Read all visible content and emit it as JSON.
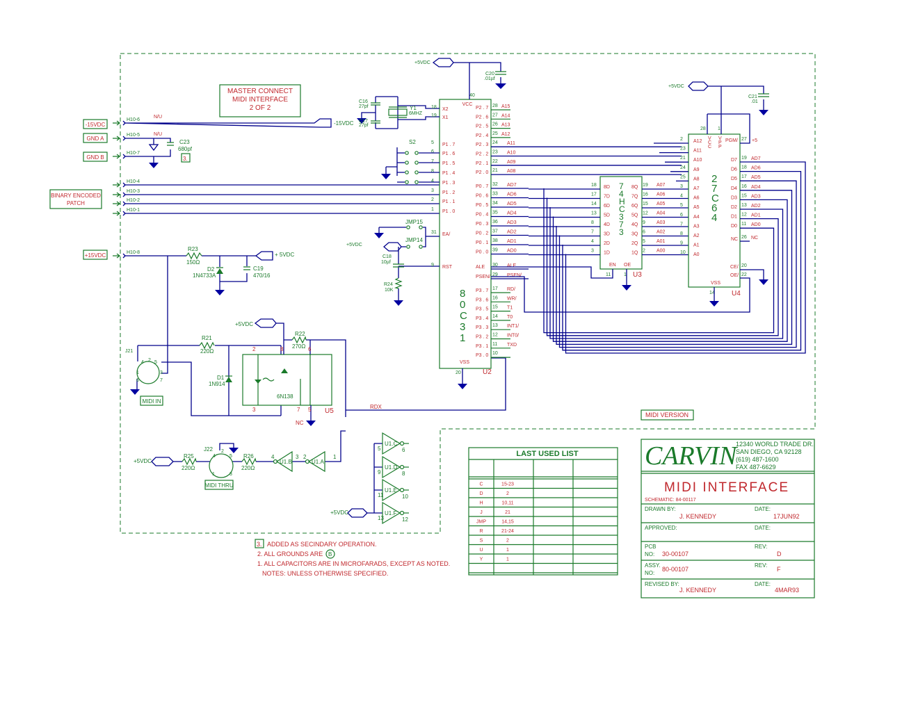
{
  "sheet": {
    "master_box": [
      "MASTER CONNECT",
      "MIDI INTERFACE",
      "2 OF 2"
    ],
    "midi_version_label": "MIDI VERSION"
  },
  "connectors": {
    "neg15": "-15VDC",
    "gnd_a": "GND A",
    "gnd_b": "GND B",
    "binary": [
      "BINARY ENCODED",
      "PATCH"
    ],
    "pos15": "+15VDC",
    "pins": [
      "H10-6",
      "H10-5",
      "H10-7",
      "H10-4",
      "H10-3",
      "H10-2",
      "H10-1",
      "H10-8"
    ],
    "nu": "N/U",
    "neg15_out": "-15VDC",
    "c23": "C23",
    "c23_val": "680pf",
    "note3": "3."
  },
  "power": {
    "r23": "R23",
    "r23_val": "150Ω",
    "d2": "D2",
    "d2_val": "1N4733A",
    "c19": "C19",
    "c19_val": "470/16",
    "out": "+ 5VDC"
  },
  "midi_in": {
    "j21": "J21",
    "label": "MIDI IN",
    "r21": "R21",
    "r21_val": "220Ω",
    "d1": "D1",
    "d1_val": "1N914",
    "r22": "R22",
    "r22_val": "270Ω",
    "vcc": "+5VDC",
    "opto": "6N138",
    "opto_ref": "U5",
    "nc": "NC",
    "rdx": "RDX",
    "pins": [
      "2",
      "8",
      "6",
      "3",
      "7",
      "5"
    ],
    "din_pins": [
      "4",
      "2",
      "5",
      "1",
      "3",
      "6",
      "7"
    ]
  },
  "midi_thru": {
    "vcc": "+5VDC",
    "r25": "R25",
    "r25_val": "220Ω",
    "j22": "J22",
    "label": "MIDI THRU",
    "r26": "R26",
    "r26_val": "220Ω",
    "u1b": "U1.B",
    "u1a": "U1.A",
    "pins": [
      "4",
      "3",
      "2",
      "1"
    ],
    "din_pins": [
      "4",
      "2",
      "5",
      "1",
      "3"
    ]
  },
  "spare_inverters": {
    "vcc": "+5VDC",
    "gates": [
      {
        "name": "U1.C",
        "in": "5",
        "out": "6"
      },
      {
        "name": "U1.D",
        "in": "9",
        "out": "8"
      },
      {
        "name": "U1.E",
        "in": "11",
        "out": "10"
      },
      {
        "name": "U1.F",
        "in": "13",
        "out": "12"
      }
    ]
  },
  "u2": {
    "ref": "U2",
    "part": [
      "8",
      "0",
      "C",
      "3",
      "1"
    ],
    "vcc": "VCC",
    "vss": "VSS",
    "vcc_pin": "40",
    "vss_pin": "20",
    "vcc_src": "+5VDC",
    "c20": "C20",
    "c20_val": ".01µf",
    "c16": "C16",
    "c16_val": "27pf",
    "c17": "C17",
    "c17_val": "27pf",
    "y1": "Y1",
    "y1_val": "6MHZ",
    "s2": "S2",
    "jmp15": "JMP15",
    "jmp14": "JMP14",
    "jmp_vcc": "+5VDC",
    "c18": "C18",
    "c18_val": "10µf",
    "r24": "R24",
    "r24_val": "10K",
    "left": [
      {
        "pin": "18",
        "name": "X2"
      },
      {
        "pin": "19",
        "name": "X1"
      },
      {
        "pin": "5",
        "name": "P1 . 7"
      },
      {
        "pin": "6",
        "name": "P1 . 6"
      },
      {
        "pin": "7",
        "name": "P1 . 5"
      },
      {
        "pin": "8",
        "name": "P1 . 4"
      },
      {
        "pin": "4",
        "name": "P1 . 3"
      },
      {
        "pin": "3",
        "name": "P1 . 2"
      },
      {
        "pin": "2",
        "name": "P1 . 1"
      },
      {
        "pin": "1",
        "name": "P1 . 0"
      },
      {
        "pin": "31",
        "name": "EA/"
      },
      {
        "pin": "9",
        "name": "RST"
      }
    ],
    "right": [
      {
        "pin": "28",
        "name": "P2 . 7",
        "net": "A15"
      },
      {
        "pin": "27",
        "name": "P2 . 6",
        "net": "A14"
      },
      {
        "pin": "26",
        "name": "P2 . 5",
        "net": "A13"
      },
      {
        "pin": "25",
        "name": "P2 . 4",
        "net": "A12"
      },
      {
        "pin": "24",
        "name": "P2 . 3",
        "net": "A11"
      },
      {
        "pin": "23",
        "name": "P2 . 2",
        "net": "A10"
      },
      {
        "pin": "22",
        "name": "P2 . 1",
        "net": "A09"
      },
      {
        "pin": "21",
        "name": "P2 . 0",
        "net": "A08"
      },
      {
        "pin": "32",
        "name": "P0 . 7",
        "net": "AD7"
      },
      {
        "pin": "33",
        "name": "P0 . 6",
        "net": "AD6"
      },
      {
        "pin": "34",
        "name": "P0 . 5",
        "net": "AD5"
      },
      {
        "pin": "35",
        "name": "P0 . 4",
        "net": "AD4"
      },
      {
        "pin": "36",
        "name": "P0 . 3",
        "net": "AD3"
      },
      {
        "pin": "37",
        "name": "P0 . 2",
        "net": "AD2"
      },
      {
        "pin": "38",
        "name": "P0 . 1",
        "net": "AD1"
      },
      {
        "pin": "39",
        "name": "P0 . 0",
        "net": "AD0"
      },
      {
        "pin": "30",
        "name": "ALE",
        "net": "ALE"
      },
      {
        "pin": "29",
        "name": "PSEN/",
        "net": "PSEN/"
      },
      {
        "pin": "17",
        "name": "P3 . 7",
        "net": "RD/"
      },
      {
        "pin": "16",
        "name": "P3 . 6",
        "net": "WR/"
      },
      {
        "pin": "15",
        "name": "P3 . 5",
        "net": "T1"
      },
      {
        "pin": "14",
        "name": "P3 . 4",
        "net": "T0"
      },
      {
        "pin": "13",
        "name": "P3 . 3",
        "net": "INT1/"
      },
      {
        "pin": "12",
        "name": "P3 . 2",
        "net": "INT0/"
      },
      {
        "pin": "11",
        "name": "P3 . 1",
        "net": "TXD"
      },
      {
        "pin": "10",
        "name": "P3 . 0",
        "net": ""
      }
    ]
  },
  "u3": {
    "ref": "U3",
    "part": [
      "7",
      "4",
      "H",
      "C",
      "3",
      "7",
      "3"
    ],
    "en": "EN",
    "oe": "OE",
    "en_pin": "11",
    "oe_pin": "1",
    "rows": [
      {
        "inpin": "18",
        "in": "8D",
        "out": "8Q",
        "outpin": "19",
        "net": "A07"
      },
      {
        "inpin": "17",
        "in": "7D",
        "out": "7Q",
        "outpin": "16",
        "net": "A06"
      },
      {
        "inpin": "14",
        "in": "6D",
        "out": "6Q",
        "outpin": "15",
        "net": "A05"
      },
      {
        "inpin": "13",
        "in": "5D",
        "out": "5Q",
        "outpin": "12",
        "net": "A04"
      },
      {
        "inpin": "8",
        "in": "4D",
        "out": "4Q",
        "outpin": "9",
        "net": "A03"
      },
      {
        "inpin": "7",
        "in": "3D",
        "out": "3Q",
        "outpin": "6",
        "net": "A02"
      },
      {
        "inpin": "4",
        "in": "2D",
        "out": "2Q",
        "outpin": "5",
        "net": "A01"
      },
      {
        "inpin": "3",
        "in": "1D",
        "out": "1Q",
        "outpin": "2",
        "net": "A00"
      }
    ]
  },
  "u4": {
    "ref": "U4",
    "part": [
      "2",
      "7",
      "C",
      "6",
      "4"
    ],
    "vcc_src": "+5VDC",
    "c21": "C21",
    "c21_val": ".01",
    "vcc_pin": "28",
    "vpp_pin": "1",
    "vss": "VSS",
    "vss_pin": "14",
    "pgm": "PGM/",
    "pgm_pin": "27",
    "pgm_net": "+5",
    "vcc_lbl": [
      "V",
      "C",
      "C"
    ],
    "vpp_lbl": [
      "V",
      "P",
      "P"
    ],
    "left": [
      {
        "pin": "2",
        "name": "A12"
      },
      {
        "pin": "23",
        "name": "A11"
      },
      {
        "pin": "21",
        "name": "A10"
      },
      {
        "pin": "24",
        "name": "A9"
      },
      {
        "pin": "25",
        "name": "A8"
      },
      {
        "pin": "3",
        "name": "A7"
      },
      {
        "pin": "4",
        "name": "A6"
      },
      {
        "pin": "5",
        "name": "A5"
      },
      {
        "pin": "6",
        "name": "A4"
      },
      {
        "pin": "7",
        "name": "A3"
      },
      {
        "pin": "8",
        "name": "A2"
      },
      {
        "pin": "9",
        "name": "A1"
      },
      {
        "pin": "10",
        "name": "A0"
      }
    ],
    "right": [
      {
        "pin": "19",
        "name": "D7",
        "net": "AD7"
      },
      {
        "pin": "18",
        "name": "D6",
        "net": "AD6"
      },
      {
        "pin": "17",
        "name": "D5",
        "net": "AD5"
      },
      {
        "pin": "16",
        "name": "D4",
        "net": "AD4"
      },
      {
        "pin": "15",
        "name": "D3",
        "net": "AD3"
      },
      {
        "pin": "13",
        "name": "D2",
        "net": "AD2"
      },
      {
        "pin": "12",
        "name": "D1",
        "net": "AD1"
      },
      {
        "pin": "11",
        "name": "D0",
        "net": "AD0"
      },
      {
        "pin": "26",
        "name": "NC",
        "net": "NC"
      }
    ],
    "ce": "CE/",
    "ce_pin": "20",
    "oe": "OE/",
    "oe_pin": "22"
  },
  "notes": {
    "n3_box": "3.",
    "n3": "ADDED AS SECINDARY OPERATION.",
    "n2": "2. ALL GROUNDS ARE",
    "n2_sym": "B",
    "n1": "1.  ALL CAPACITORS ARE IN MICROFARADS, EXCEPT AS NOTED.",
    "header": "NOTES:  UNLESS OTHERWISE SPECIFIED."
  },
  "last_used": {
    "title": "LAST USED LIST",
    "rows": [
      [
        "C",
        "15-23"
      ],
      [
        "D",
        "2"
      ],
      [
        "H",
        "10,11"
      ],
      [
        "J",
        "21"
      ],
      [
        "JMP",
        "14,15"
      ],
      [
        "R",
        "21-24"
      ],
      [
        "S",
        "2"
      ],
      [
        "U",
        "1"
      ],
      [
        "Y",
        "1"
      ],
      [
        "",
        ""
      ]
    ]
  },
  "title_block": {
    "company": "CARVIN",
    "address": [
      "12340 WORLD TRADE DR.",
      "SAN DIEGO, CA  92128",
      "(619) 487-1600",
      "FAX 487-6629"
    ],
    "title": "MIDI INTERFACE",
    "schematic": "SCHEMATIC:  84-00117",
    "drawn_by_lbl": "DRAWN BY:",
    "drawn_by": "J. KENNEDY",
    "date_lbl": "DATE:",
    "drawn_date": "17JUN92",
    "approved_lbl": "APPROVED:",
    "pcb_lbl": [
      "PCB",
      "NO:"
    ],
    "pcb": "30-00107",
    "rev_lbl": "REV:",
    "pcb_rev": "D",
    "assy_lbl": [
      "ASSY.",
      "NO:"
    ],
    "assy": "80-00107",
    "assy_rev": "F",
    "revised_lbl": "REVISED BY:",
    "revised_by": "J. KENNEDY",
    "revised_date": "4MAR93"
  }
}
